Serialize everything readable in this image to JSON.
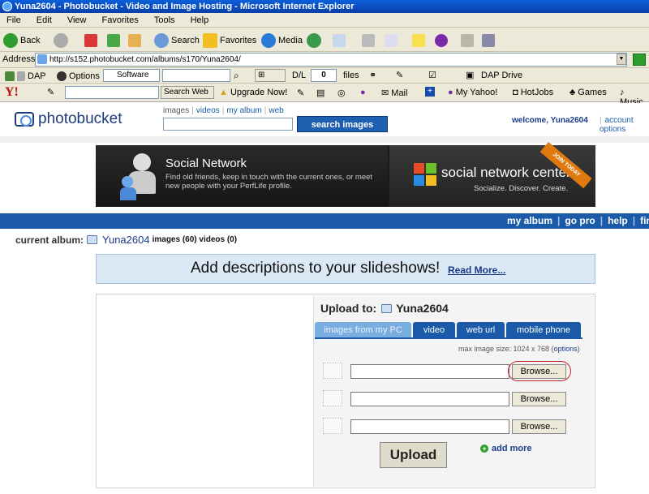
{
  "window": {
    "title": "Yuna2604 - Photobucket - Video and Image Hosting - Microsoft Internet Explorer"
  },
  "menu": [
    "File",
    "Edit",
    "View",
    "Favorites",
    "Tools",
    "Help"
  ],
  "toolbar": {
    "back": "Back",
    "search": "Search",
    "favorites": "Favorites",
    "media": "Media"
  },
  "address": {
    "label": "Address",
    "url": "http://s152.photobucket.com/albums/s170/Yuna2604/"
  },
  "dapbar": {
    "dap": "DAP",
    "options": "Options",
    "software": "Software",
    "dl": "D/L",
    "dl_count": "0",
    "files": "files",
    "dap_drive": "DAP Drive"
  },
  "yahoobar": {
    "search_web": "Search Web",
    "upgrade": "Upgrade Now!",
    "mail": "Mail",
    "my_yahoo": "My Yahoo!",
    "hotjobs": "HotJobs",
    "games": "Games",
    "music": "Music"
  },
  "pb": {
    "logo": "photobucket",
    "search_tabs": [
      "images",
      "videos",
      "my album",
      "web"
    ],
    "search_button": "search images",
    "welcome": "welcome, Yuna2604",
    "account": "account options"
  },
  "banner": {
    "left_title": "Social Network",
    "left_text": "Find old friends, keep in touch with the current ones, or meet new people with your PerfLife profile.",
    "right_title": "social network center",
    "right_sub": "Socialize. Discover. Create.",
    "ribbon": "JOIN TODAY"
  },
  "nav": {
    "links": [
      "my album",
      "go pro",
      "help",
      "find"
    ]
  },
  "current_album": {
    "label": "current album:",
    "name": "Yuna2604",
    "counts": "images (60) videos (0)"
  },
  "promo": {
    "text": "Add descriptions to your slideshows!",
    "link": "Read More..."
  },
  "upload": {
    "title": "Upload to:",
    "album": "Yuna2604",
    "tabs": [
      "images from my PC",
      "video",
      "web url",
      "mobile phone"
    ],
    "max_size_prefix": "max image size: 1024 x 768 (",
    "max_size_link": "options",
    "max_size_suffix": ")",
    "browse": "Browse...",
    "upload_button": "Upload",
    "add_more": "add more"
  }
}
